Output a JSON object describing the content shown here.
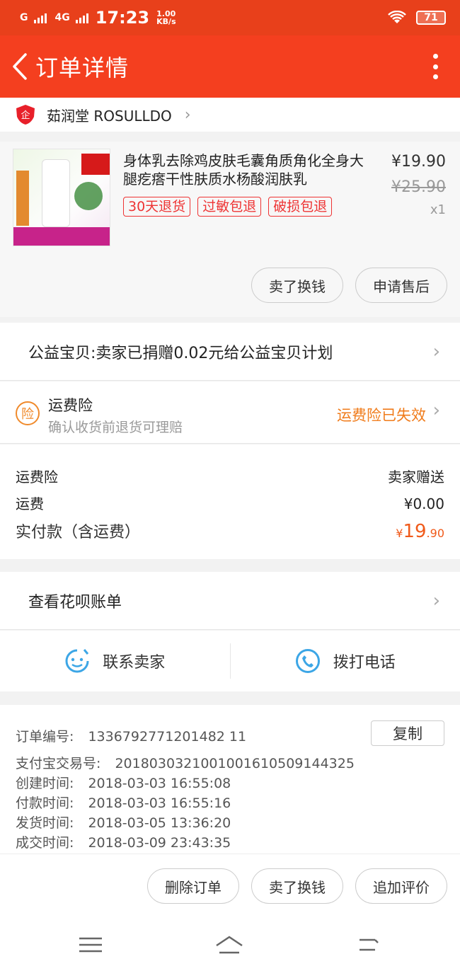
{
  "status_bar": {
    "signal_label": "G",
    "network_label": "4G",
    "time": "17:23",
    "speed_value": "1.00",
    "speed_unit": "KB/s",
    "battery": "71"
  },
  "title_bar": {
    "title": "订单详情"
  },
  "shop": {
    "name": "茹润堂 ROSULLDO"
  },
  "product": {
    "title": "身体乳去除鸡皮肤毛囊角质角化全身大腿疙瘩干性肤质水杨酸润肤乳",
    "price": "¥19.90",
    "original_price": "¥25.90",
    "quantity": "x1",
    "tags": [
      "30天退货",
      "过敏包退",
      "破损包退"
    ],
    "buttons": {
      "sell": "卖了换钱",
      "after_sale": "申请售后"
    }
  },
  "charity": {
    "text": "公益宝贝:卖家已捐赠0.02元给公益宝贝计划"
  },
  "insurance": {
    "icon_char": "险",
    "title": "运费险",
    "subtitle": "确认收货前退货可理赔",
    "status": "运费险已失效"
  },
  "costs": {
    "insurance_label": "运费险",
    "insurance_value": "卖家赠送",
    "shipping_label": "运费",
    "shipping_value": "¥0.00",
    "paid_label": "实付款（含运费）",
    "paid_currency": "¥",
    "paid_integer": "19",
    "paid_decimal": ".90"
  },
  "huabei": {
    "text": "查看花呗账单"
  },
  "contact": {
    "seller": "联系卖家",
    "phone": "拨打电话"
  },
  "order_info": {
    "order_no_label": "订单编号:",
    "order_no": "1336792771201482 11",
    "copy": "复制",
    "alipay_label": "支付宝交易号:",
    "alipay_no": "2018030321001001610509144325",
    "created_label": "创建时间:",
    "created": "2018-03-03 16:55:08",
    "paid_label": "付款时间:",
    "paid": "2018-03-03 16:55:16",
    "shipped_label": "发货时间:",
    "shipped": "2018-03-05 13:36:20",
    "completed_label": "成交时间:",
    "completed": "2018-03-09 23:43:35"
  },
  "actions": {
    "delete": "删除订单",
    "sell": "卖了换钱",
    "review": "追加评价"
  },
  "colors": {
    "accent": "#f43f1f",
    "status_bar": "#e8401b",
    "orange": "#f07b1a",
    "blue_icon": "#3ca6e6"
  }
}
